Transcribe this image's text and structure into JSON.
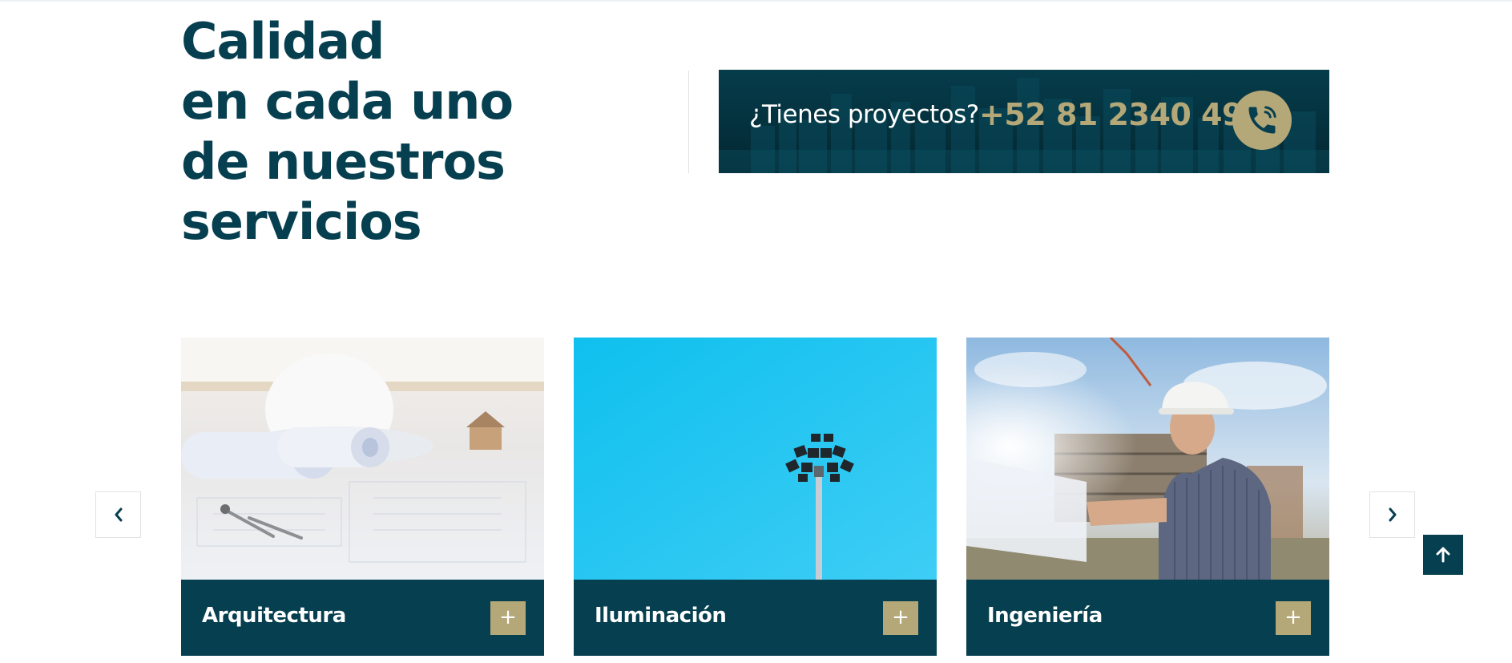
{
  "headline": {
    "lines": [
      "Calidad",
      "en cada uno",
      "de nuestros",
      "servicios"
    ]
  },
  "cta": {
    "question": "¿Tienes proyectos?",
    "phone": "+52 81 2340 4908",
    "icon": "phone-icon"
  },
  "services": [
    {
      "title": "Arquitectura",
      "plus": "+"
    },
    {
      "title": "Iluminación",
      "plus": "+"
    },
    {
      "title": "Ingeniería",
      "plus": "+"
    }
  ],
  "carousel": {
    "prev_icon": "chevron-left-icon",
    "next_icon": "chevron-right-icon"
  },
  "scroll_top": {
    "icon": "arrow-up-icon"
  },
  "colors": {
    "primary": "#063f4f",
    "accent": "#b5a878",
    "background": "#ffffff"
  }
}
